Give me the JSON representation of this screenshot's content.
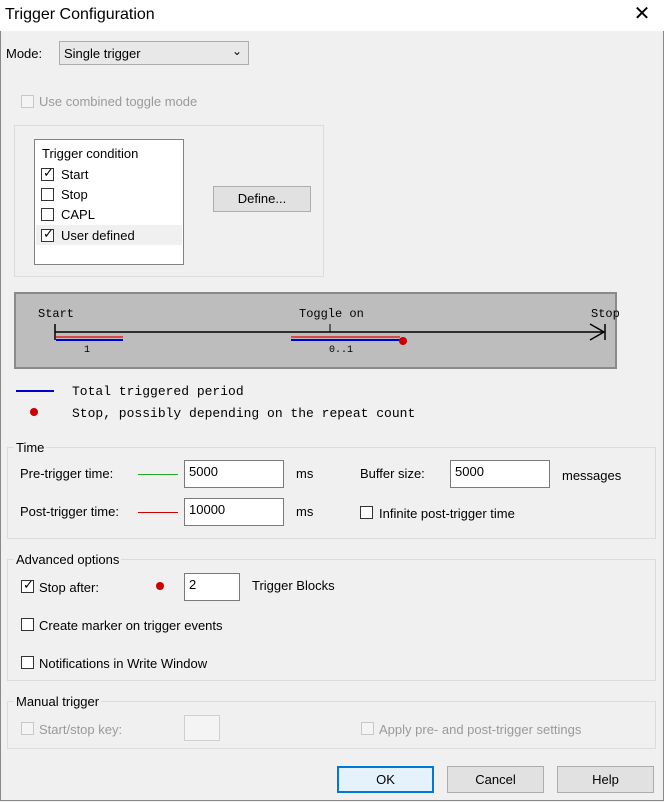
{
  "window": {
    "title": "Trigger Configuration"
  },
  "mode": {
    "label": "Mode:",
    "value": "Single trigger"
  },
  "combined_toggle": {
    "label": "Use combined toggle mode"
  },
  "trigger_condition": {
    "header": "Trigger condition",
    "items": [
      {
        "label": "Start",
        "checked": true
      },
      {
        "label": "Stop",
        "checked": false
      },
      {
        "label": "CAPL",
        "checked": false
      },
      {
        "label": "User defined",
        "checked": true
      }
    ],
    "define_button": "Define..."
  },
  "diagram": {
    "start_label": "Start",
    "toggle_label": "Toggle on",
    "stop_label": "Stop",
    "count_1": "1",
    "count_range": "0..1"
  },
  "legend": {
    "total": "Total triggered period",
    "stop": "Stop, possibly depending on the repeat count"
  },
  "time": {
    "group": "Time",
    "pre_label": "Pre-trigger time:",
    "pre_value": "5000",
    "pre_unit": "ms",
    "post_label": "Post-trigger time:",
    "post_value": "10000",
    "post_unit": "ms",
    "buffer_label": "Buffer size:",
    "buffer_value": "5000",
    "buffer_unit": "messages",
    "infinite_label": "Infinite post-trigger time"
  },
  "advanced": {
    "group": "Advanced options",
    "stop_after_label": "Stop after:",
    "stop_after_value": "2",
    "trigger_blocks": "Trigger Blocks",
    "create_marker": "Create marker on trigger events",
    "notifications": "Notifications in Write Window"
  },
  "manual": {
    "group": "Manual trigger",
    "start_stop_key": "Start/stop key:",
    "apply_settings": "Apply pre- and post-trigger settings"
  },
  "buttons": {
    "ok": "OK",
    "cancel": "Cancel",
    "help": "Help"
  },
  "colors": {
    "blue": "#0000cc",
    "red": "#cc0000",
    "green": "#22aa22",
    "accent": "#0078d7"
  }
}
